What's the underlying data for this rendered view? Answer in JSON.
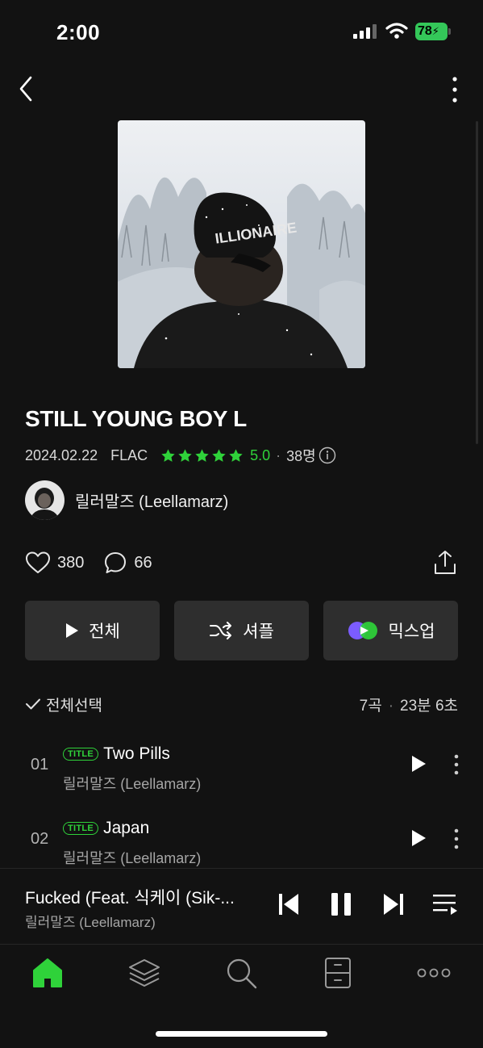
{
  "status_bar": {
    "time": "2:00",
    "battery": "78"
  },
  "album": {
    "title": "STILL YOUNG BOY L",
    "date": "2024.02.22",
    "format": "FLAC",
    "rating": "5.0",
    "rating_count": "38명",
    "artist": "릴러말즈 (Leellamarz)",
    "likes": "380",
    "comments": "66"
  },
  "actions": {
    "play_all": "전체",
    "shuffle": "셔플",
    "mixup": "믹스업"
  },
  "list_header": {
    "select_all": "전체선택",
    "track_count": "7곡",
    "duration": "23분 6초"
  },
  "tracks": [
    {
      "num": "01",
      "badge": "TITLE",
      "title": "Two Pills",
      "artist": "릴러말즈 (Leellamarz)"
    },
    {
      "num": "02",
      "badge": "TITLE",
      "title": "Japan",
      "artist": "릴러말즈 (Leellamarz)"
    }
  ],
  "now_playing": {
    "title": "Fucked (Feat. 식케이 (Sik-...",
    "artist": "릴러말즈 (Leellamarz)"
  },
  "colors": {
    "accent": "#2fd23a",
    "background": "#121212",
    "button": "#2e2e2e"
  },
  "icons": [
    "back-icon",
    "more-icon",
    "star-icon",
    "info-icon",
    "heart-icon",
    "comment-icon",
    "share-icon",
    "play-icon",
    "shuffle-icon",
    "mixup-icon",
    "check-icon",
    "previous-icon",
    "pause-icon",
    "next-icon",
    "playlist-icon",
    "home-icon",
    "library-icon",
    "search-icon",
    "locker-icon",
    "more-horizontal-icon"
  ]
}
